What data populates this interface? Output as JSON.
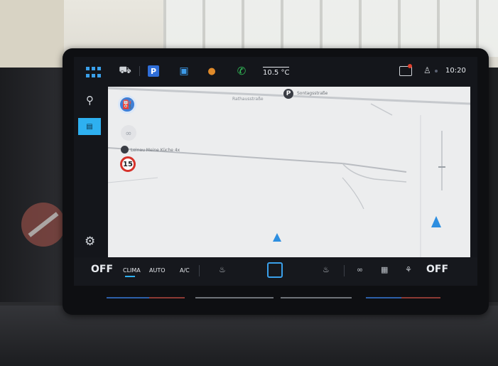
{
  "status_bar": {
    "temperature": "10.5 °C",
    "time": "10:20",
    "parking_label": "P",
    "icons": [
      "apps-grid-icon",
      "car-icon",
      "parking-icon",
      "seat-icon",
      "food-icon",
      "phone-icon",
      "message-icon",
      "profile-icon"
    ]
  },
  "map": {
    "labels": [
      "Rathausstraße",
      "Leinau Meine Küche 4x",
      "Sontagsstraße"
    ],
    "poi_p": "P",
    "speed_limit": "15"
  },
  "climate": {
    "left_temp": "OFF",
    "clima": "CLIMA",
    "auto": "AUTO",
    "ac": "A/C",
    "right_temp": "OFF"
  },
  "colors": {
    "accent": "#2eb0f0",
    "speed_ring": "#d6332b",
    "nav_arrow": "#2d8ee0"
  }
}
